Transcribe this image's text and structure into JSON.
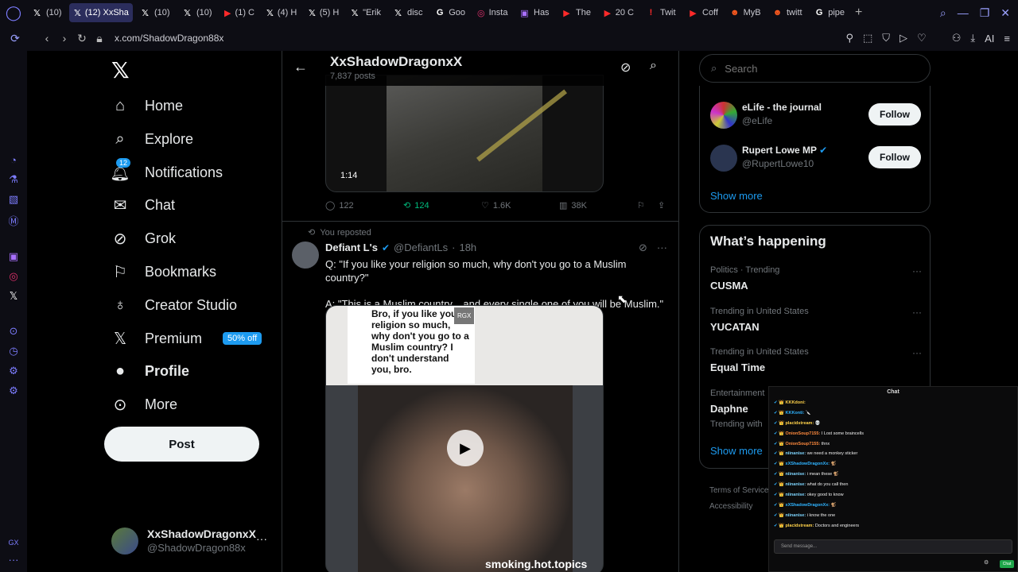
{
  "tabs": [
    {
      "label": "(10)",
      "icon": "x-icon",
      "active": false
    },
    {
      "label": "(12) XxSha",
      "icon": "x-icon",
      "active": true
    },
    {
      "label": "(10)",
      "icon": "x-icon",
      "active": false
    },
    {
      "label": "(10)",
      "icon": "x-icon",
      "active": false
    },
    {
      "label": "(1) C",
      "icon": "youtube-icon",
      "active": false
    },
    {
      "label": "(4) H",
      "icon": "x-icon",
      "active": false
    },
    {
      "label": "(5) H",
      "icon": "x-icon",
      "active": false
    },
    {
      "label": "\"Erik",
      "icon": "x-icon",
      "active": false
    },
    {
      "label": "disc",
      "icon": "x-icon",
      "active": false
    },
    {
      "label": "Goo",
      "icon": "google-icon",
      "active": false
    },
    {
      "label": "Insta",
      "icon": "instagram-icon",
      "active": false
    },
    {
      "label": "Has",
      "icon": "twitch-icon",
      "active": false
    },
    {
      "label": "The",
      "icon": "youtube-icon",
      "active": false
    },
    {
      "label": "20 C",
      "icon": "youtube-icon",
      "active": false
    },
    {
      "label": "Twit",
      "icon": "alert-icon",
      "active": false
    },
    {
      "label": "Coff",
      "icon": "youtube-icon",
      "active": false
    },
    {
      "label": "MyB",
      "icon": "reddit-icon",
      "active": false
    },
    {
      "label": "twitt",
      "icon": "reddit-icon",
      "active": false
    },
    {
      "label": "pipe",
      "icon": "google-icon",
      "active": false
    }
  ],
  "browser": {
    "url": "x.com/ShadowDragon88x",
    "ai_label": "AI",
    "gx_label": "GX"
  },
  "nav": {
    "home": "Home",
    "explore": "Explore",
    "notifications": "Notifications",
    "notif_count": "12",
    "chat": "Chat",
    "grok": "Grok",
    "bookmarks": "Bookmarks",
    "creator": "Creator Studio",
    "premium": "Premium",
    "premium_badge": "50% off",
    "profile": "Profile",
    "more": "More",
    "post_button": "Post"
  },
  "account": {
    "name": "XxShadowDragonxX",
    "handle": "@ShadowDragon88x",
    "more": "···"
  },
  "header": {
    "name": "XxShadowDragonxX",
    "posts": "7,837 posts"
  },
  "post1": {
    "duration": "1:14",
    "replies": "122",
    "reposts": "124",
    "likes": "1.6K",
    "views": "38K"
  },
  "post2": {
    "repost_label": "You reposted",
    "name": "Defiant L's",
    "handle": "@DefiantLs",
    "time": "18h",
    "line1": "Q: \"If you like your religion so much, why don't you go to a Muslim country?\"",
    "line2": "A: \"This is a Muslim country... and every single one of you will be Muslim.\"",
    "caption": "Bro, if you like your religion so much, why don't you go to a Muslim country? I don't understand you, bro.",
    "badge": "RGX",
    "watermark": "smoking.hot.topics"
  },
  "right": {
    "search_placeholder": "Search",
    "who": [
      {
        "name": "eLife - the journal",
        "handle": "@eLife",
        "button": "Follow"
      },
      {
        "name": "Rupert Lowe MP",
        "handle": "@RupertLowe10",
        "button": "Follow"
      }
    ],
    "show_more": "Show more",
    "happening_title": "What’s happening",
    "trends": [
      {
        "meta": "Politics · Trending",
        "name": "CUSMA"
      },
      {
        "meta": "Trending in United States",
        "name": "YUCATAN"
      },
      {
        "meta": "Trending in United States",
        "name": "Equal Time"
      },
      {
        "meta": "Entertainment",
        "name": "Daphne",
        "sub": "Trending with"
      }
    ],
    "show_more2": "Show more",
    "footer1": "Terms of Service",
    "footer2": "Accessibility"
  },
  "chat": {
    "title": "Chat",
    "lines": [
      {
        "user": "KKKdoni:",
        "msg": "",
        "color": "#ffd24a"
      },
      {
        "user": "KKKonti:",
        "msg": "🔪",
        "color": "#2fb3ff"
      },
      {
        "user": "placidstream:",
        "msg": "💀",
        "color": "#ffd24a"
      },
      {
        "user": "OnionSoup7155:",
        "msg": "I Lost some braincells",
        "color": "#ff8a3d"
      },
      {
        "user": "OnionSoup7155:",
        "msg": "thnx",
        "color": "#ff8a3d"
      },
      {
        "user": "niinanise:",
        "msg": "we need a monkey sticker",
        "color": "#7dd3fc"
      },
      {
        "user": "xXShadowDragonXx:",
        "msg": "🐒",
        "color": "#2fb3ff"
      },
      {
        "user": "niinanise:",
        "msg": "i mean these 🐒",
        "color": "#7dd3fc"
      },
      {
        "user": "niinanise:",
        "msg": "what do you call then",
        "color": "#7dd3fc"
      },
      {
        "user": "niinanise:",
        "msg": "okey good to know",
        "color": "#7dd3fc"
      },
      {
        "user": "xXShadowDragonXx:",
        "msg": "🐒",
        "color": "#2fb3ff"
      },
      {
        "user": "niinanise:",
        "msg": "i know the one",
        "color": "#7dd3fc"
      },
      {
        "user": "placidstream:",
        "msg": "Doctors and engineers",
        "color": "#ffd24a"
      }
    ],
    "input_placeholder": "Send message...",
    "send": "Chat"
  }
}
